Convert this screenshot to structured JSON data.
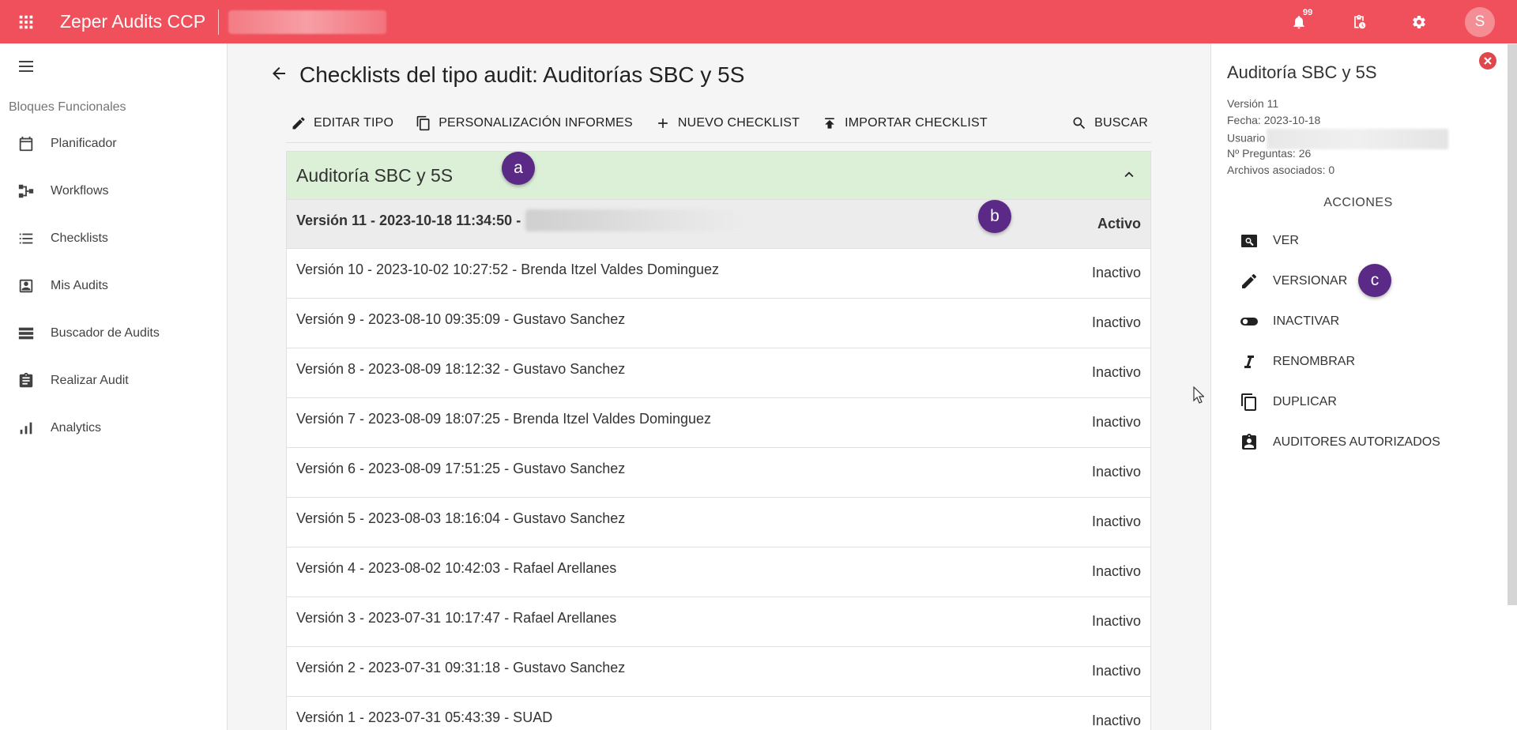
{
  "topbar": {
    "app_title": "Zeper Audits CCP",
    "notification_count": "99",
    "avatar_letter": "S",
    "background_color": "#f0505c"
  },
  "sidebar": {
    "section_label": "Bloques Funcionales",
    "items": [
      {
        "label": "Planificador",
        "icon": "calendar-icon"
      },
      {
        "label": "Workflows",
        "icon": "workflow-icon"
      },
      {
        "label": "Checklists",
        "icon": "checklist-icon"
      },
      {
        "label": "Mis Audits",
        "icon": "account-box-icon"
      },
      {
        "label": "Buscador de Audits",
        "icon": "list-storage-icon"
      },
      {
        "label": "Realizar Audit",
        "icon": "clipboard-icon"
      },
      {
        "label": "Analytics",
        "icon": "bar-chart-icon"
      }
    ]
  },
  "main": {
    "page_title": "Checklists del tipo audit: Auditorías SBC y 5S",
    "toolbar": {
      "edit_type": "EDITAR TIPO",
      "report_custom": "PERSONALIZACIÓN INFORMES",
      "new_checklist": "NUEVO CHECKLIST",
      "import_checklist": "IMPORTAR CHECKLIST",
      "search": "BUSCAR"
    },
    "panel_title": "Auditoría SBC y 5S",
    "panel_color": "#dcf0d8",
    "versions": [
      {
        "text": "Versión 11 - 2023-10-18 11:34:50 -",
        "status": "Activo"
      },
      {
        "text": "Versión 10 - 2023-10-02 10:27:52 - Brenda Itzel Valdes Dominguez",
        "status": "Inactivo"
      },
      {
        "text": "Versión 9 - 2023-08-10 09:35:09 - Gustavo Sanchez",
        "status": "Inactivo"
      },
      {
        "text": "Versión 8 - 2023-08-09 18:12:32 - Gustavo Sanchez",
        "status": "Inactivo"
      },
      {
        "text": "Versión 7 - 2023-08-09 18:07:25 - Brenda Itzel Valdes Dominguez",
        "status": "Inactivo"
      },
      {
        "text": "Versión 6 - 2023-08-09 17:51:25 - Gustavo Sanchez",
        "status": "Inactivo"
      },
      {
        "text": "Versión 5 - 2023-08-03 18:16:04 - Gustavo Sanchez",
        "status": "Inactivo"
      },
      {
        "text": "Versión 4 - 2023-08-02 10:42:03 - Rafael Arellanes",
        "status": "Inactivo"
      },
      {
        "text": "Versión 3 - 2023-07-31 10:17:47 - Rafael Arellanes",
        "status": "Inactivo"
      },
      {
        "text": "Versión 2 - 2023-07-31 09:31:18 - Gustavo Sanchez",
        "status": "Inactivo"
      },
      {
        "text": "Versión 1 - 2023-07-31 05:43:39 - SUAD",
        "status": "Inactivo"
      }
    ]
  },
  "markers": {
    "a": "a",
    "b": "b",
    "c": "c",
    "color": "#5b2a86"
  },
  "details": {
    "title": "Auditoría SBC y 5S",
    "version": "Versión 11",
    "date": "Fecha: 2023-10-18",
    "user_label": "Usuario",
    "questions": "Nº Preguntas: 26",
    "files": "Archivos asociados: 0",
    "actions_label": "ACCIONES",
    "actions": [
      {
        "label": "VER",
        "icon": "view-icon"
      },
      {
        "label": "VERSIONAR",
        "icon": "pencil-icon"
      },
      {
        "label": "INACTIVAR",
        "icon": "toggle-icon"
      },
      {
        "label": "RENOMBRAR",
        "icon": "italic-icon"
      },
      {
        "label": "DUPLICAR",
        "icon": "copy-icon"
      },
      {
        "label": "AUDITORES AUTORIZADOS",
        "icon": "assignment-ind-icon"
      }
    ]
  }
}
